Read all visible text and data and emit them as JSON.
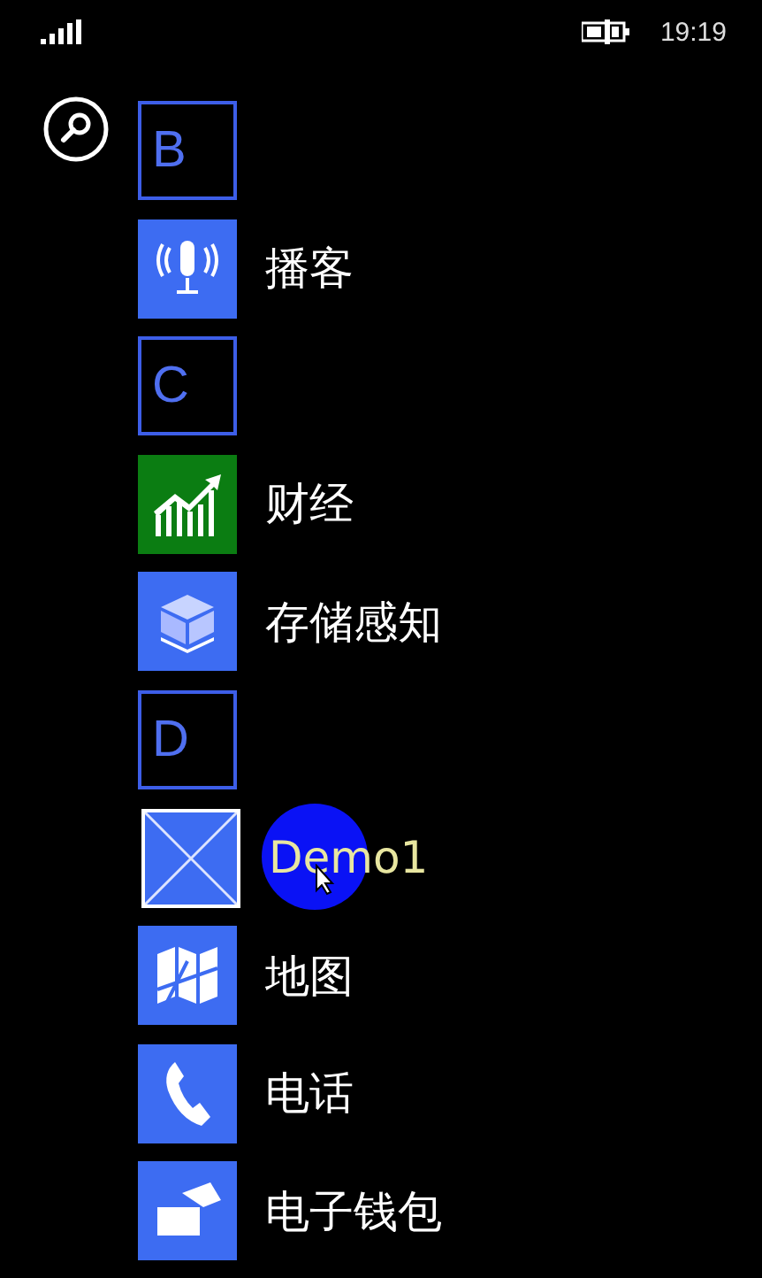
{
  "status_bar": {
    "time": "19:19"
  },
  "items": [
    {
      "kind": "header",
      "letter": "B"
    },
    {
      "kind": "app",
      "label": "播客",
      "color": "#3d6cf2",
      "pressed": false
    },
    {
      "kind": "header",
      "letter": "C"
    },
    {
      "kind": "app",
      "label": "财经",
      "color": "#0b7d12",
      "pressed": false
    },
    {
      "kind": "app",
      "label": "存储感知",
      "color": "#3d6cf2",
      "pressed": false
    },
    {
      "kind": "header",
      "letter": "D"
    },
    {
      "kind": "app",
      "label": "Demo1",
      "color": "#3d6cf2",
      "pressed": true
    },
    {
      "kind": "app",
      "label": "地图",
      "color": "#3d6cf2",
      "pressed": false
    },
    {
      "kind": "app",
      "label": "电话",
      "color": "#3d6cf2",
      "pressed": false
    },
    {
      "kind": "app",
      "label": "电子钱包",
      "color": "#3d6cf2",
      "pressed": false
    }
  ]
}
